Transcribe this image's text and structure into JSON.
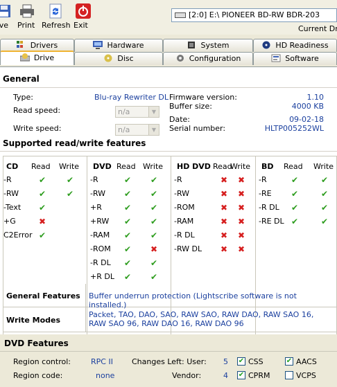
{
  "toolbar": {
    "save": "ave",
    "print": "Print",
    "refresh": "Refresh",
    "exit": "Exit",
    "drive": "[2:0]  E:\\ PIONEER  BD-RW   BDR-203",
    "current_drive": "Current Driv"
  },
  "tabs_top": [
    "Drivers",
    "Hardware",
    "System",
    "HD Readiness"
  ],
  "tabs_bottom": [
    "Drive",
    "Disc",
    "Configuration",
    "Software"
  ],
  "active_tab": "Drive",
  "general": {
    "title": "General",
    "type_label": "Type:",
    "type_value": "Blu-ray Rewriter DL",
    "read_speed_label": "Read speed:",
    "read_speed_value": "n/a",
    "write_speed_label": "Write speed:",
    "write_speed_value": "n/a",
    "firmware_label": "Firmware version:",
    "firmware_value": "1.10",
    "buffer_label": "Buffer size:",
    "buffer_value": "4000 KB",
    "date_label": "Date:",
    "date_value": "09-02-18",
    "serial_label": "Serial number:",
    "serial_value": "HLTP005252WL"
  },
  "features": {
    "title": "Supported read/write features",
    "read_header": "Read",
    "write_header": "Write",
    "groups": [
      {
        "name": "CD",
        "rows": [
          {
            "label": "-R",
            "read": "ok",
            "write": "ok"
          },
          {
            "label": "-RW",
            "read": "ok",
            "write": "ok"
          },
          {
            "label": "-Text",
            "read": "ok",
            "write": "blank"
          },
          {
            "label": "+G",
            "read": "no",
            "write": "blank"
          },
          {
            "label": "C2Error",
            "read": "ok",
            "write": "blank"
          }
        ]
      },
      {
        "name": "DVD",
        "rows": [
          {
            "label": "-R",
            "read": "ok",
            "write": "ok"
          },
          {
            "label": "-RW",
            "read": "ok",
            "write": "ok"
          },
          {
            "label": "+R",
            "read": "ok",
            "write": "ok"
          },
          {
            "label": "+RW",
            "read": "ok",
            "write": "ok"
          },
          {
            "label": "-RAM",
            "read": "ok",
            "write": "ok"
          },
          {
            "label": "-ROM",
            "read": "ok",
            "write": "no"
          },
          {
            "label": "-R DL",
            "read": "ok",
            "write": "ok"
          },
          {
            "label": "+R DL",
            "read": "ok",
            "write": "ok"
          }
        ]
      },
      {
        "name": "HD DVD",
        "rows": [
          {
            "label": "-R",
            "read": "no",
            "write": "no"
          },
          {
            "label": "-RW",
            "read": "no",
            "write": "no"
          },
          {
            "label": "-ROM",
            "read": "no",
            "write": "no"
          },
          {
            "label": "-RAM",
            "read": "no",
            "write": "no"
          },
          {
            "label": "-R DL",
            "read": "no",
            "write": "no"
          },
          {
            "label": "-RW DL",
            "read": "no",
            "write": "no"
          }
        ]
      },
      {
        "name": "BD",
        "rows": [
          {
            "label": "-R",
            "read": "ok",
            "write": "ok"
          },
          {
            "label": "-RE",
            "read": "ok",
            "write": "ok"
          },
          {
            "label": "-R DL",
            "read": "ok",
            "write": "ok"
          },
          {
            "label": "-RE DL",
            "read": "ok",
            "write": "ok"
          }
        ]
      }
    ]
  },
  "general_features": {
    "label": "General Features",
    "value": "Buffer underrun protection (Lightscribe software is not installed.)"
  },
  "write_modes": {
    "label": "Write Modes",
    "value": "Packet, TAO, DAO, SAO, RAW SAO, RAW DAO, RAW SAO 16, RAW SAO 96, RAW DAO 16, RAW DAO 96"
  },
  "dvd_features": {
    "title": "DVD Features",
    "region_control_label": "Region control:",
    "region_control_value": "RPC II",
    "changes_user_label": "Changes Left: User:",
    "changes_user_value": "5",
    "region_code_label": "Region code:",
    "region_code_value": "none",
    "vendor_label": "Vendor:",
    "vendor_value": "4",
    "css_label": "CSS",
    "css_checked": true,
    "aacs_label": "AACS",
    "aacs_checked": true,
    "cprm_label": "CPRM",
    "cprm_checked": true,
    "vcps_label": "VCPS",
    "vcps_checked": false
  },
  "colors": {
    "ok": "#2e9d1f",
    "no": "#d61f1f",
    "value_text": "#1a3f9e",
    "exit_red": "#d42222"
  }
}
